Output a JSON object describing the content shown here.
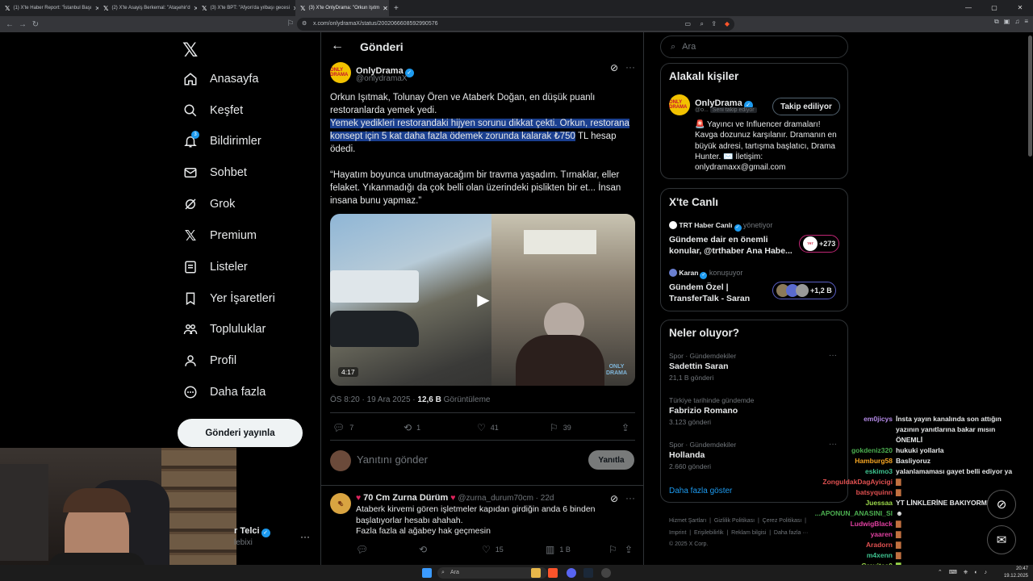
{
  "browser": {
    "tabs": [
      {
        "title": "(1) X'te Haber Report: \"İstanbul Başı"
      },
      {
        "title": "(2) X'te Asayiş Berkemal: \"Ataşehir'd"
      },
      {
        "title": "(3) X'te BPT: \"Afyon'da yılbaşı gecesi"
      },
      {
        "title": "(3) X'te OnlyDrama: \"Orkun Işıtm"
      }
    ],
    "url": "x.com/onlydramaX/status/2002066608592990576"
  },
  "sidebar": {
    "items": [
      {
        "label": "Anasayfa",
        "icon": "home-icon"
      },
      {
        "label": "Keşfet",
        "icon": "search-icon"
      },
      {
        "label": "Bildirimler",
        "icon": "bell-icon",
        "badge": "3"
      },
      {
        "label": "Sohbet",
        "icon": "mail-icon"
      },
      {
        "label": "Grok",
        "icon": "grok-icon"
      },
      {
        "label": "Premium",
        "icon": "x-premium-icon"
      },
      {
        "label": "Listeler",
        "icon": "list-icon"
      },
      {
        "label": "Yer İşaretleri",
        "icon": "bookmark-icon"
      },
      {
        "label": "Topluluklar",
        "icon": "communities-icon"
      },
      {
        "label": "Profil",
        "icon": "profile-icon"
      },
      {
        "label": "Daha fazla",
        "icon": "more-icon"
      }
    ],
    "post_button": "Gönderi yayınla",
    "account_name": "r Telci",
    "account_handle": "lebixi"
  },
  "main": {
    "header_title": "Gönderi",
    "post": {
      "author": "OnlyDrama",
      "handle": "@onlydramaX",
      "avatar_text": "ONLY DRAMA",
      "text_1": "Orkun Işıtmak, Tolunay Ören ve Ataberk Doğan, en düşük puanlı restoranlarda yemek yedi.",
      "text_2_highlight": "Yemek yedikleri restorandaki hijyen sorunu dikkat çekti. Orkun, restorana konsept için 5 kat daha fazla ödemek zorunda kalarak ₺750",
      "text_2_rest": " TL hesap ödedi.",
      "text_3": "“Hayatım boyunca unutmayacağım bir travma yaşadım. Tırnaklar, eller felaket. Yıkanmadığı da çok belli olan üzerindeki pislikten bir et... İnsan insana bunu yapmaz.”",
      "video_duration": "4:17",
      "video_watermark": "ONLY DRAMA",
      "time": "ÖS 8:20 · 19 Ara 2025 · ",
      "views_count": "12,6 B",
      "views_label": " Görüntüleme",
      "replies": "7",
      "reposts": "1",
      "likes": "41",
      "bookmarks": "39"
    },
    "reply_placeholder": "Yanıtını gönder",
    "reply_button": "Yanıtla",
    "comment": {
      "author": "70 Cm Zurna Dürüm",
      "handle": "@zurna_durum70cm · 22d",
      "text": "Ataberk kirvemi gören işletmeler kapıdan girdiğin anda 6 binden başlatıyorlar hesabı ahahah.\nFazla fazla al ağabey hak geçmesin",
      "reposts": "",
      "likes": "15",
      "views": "1 B"
    }
  },
  "right": {
    "search_placeholder": "Ara",
    "related_title": "Alakalı kişiler",
    "related": {
      "name": "OnlyDrama",
      "handle": "@o...",
      "follows_you": "Seni takip ediyor",
      "button": "Takip ediliyor",
      "bio": "🚨 Yayıncı ve Influencer dramaları! Kavga dozunuz karşılanır. Dramanın en büyük adresi, tartışma başlatıcı, Drama Hunter. ✉️ İletişim: onlydramaxx@gmail.com"
    },
    "live_title": "X'te Canlı",
    "live": [
      {
        "host": "TRT Haber Canlı",
        "role": "yönetiyor",
        "title": "Gündeme dair en önemli konular, @trthaber Ana Habe...",
        "count": "+273"
      },
      {
        "host": "Karan",
        "role": "konuşuyor",
        "title": "Gündem Özel | TransferTalk - Saran",
        "count": "+1,2 B"
      }
    ],
    "trends_title": "Neler oluyor?",
    "trends": [
      {
        "context": "Spor · Gündemdekiler",
        "name": "Sadettin Saran",
        "count": "21,1 B gönderi"
      },
      {
        "context": "Türkiye tarihinde gündemde",
        "name": "Fabrizio Romano",
        "count": "3.123 gönderi"
      },
      {
        "context": "Spor · Gündemdekiler",
        "name": "Hollanda",
        "count": "2.660 gönderi"
      }
    ],
    "show_more": "Daha fazla göster",
    "footer_line1": "Hizmet Şartları  |  Gizlilik Politikası  |  Çerez Politikası  |",
    "footer_line2": "Imprint  |  Erişilebilirlik  |  Reklam bilgisi  |  Daha fazla ···",
    "footer_line3": "© 2025 X Corp."
  },
  "chat": [
    {
      "name": "em0jicys",
      "msg": "İnsta yayın kanalında son attığın yazının yanıtlarına bakar mısın ÖNEMLİ",
      "color": "#b58be8"
    },
    {
      "name": "gokdeniz320",
      "msg": "hukuki yollarla",
      "color": "#4caf50"
    },
    {
      "name": "Hamburg58",
      "msg": "Basliyoruz",
      "color": "#f6a623"
    },
    {
      "name": "eskimo3",
      "msg": "yalanlamaması gayet belli ediyor ya",
      "color": "#3ec28f"
    },
    {
      "name": "ZonguldakDagAyicigi",
      "msg": "",
      "color": "#e05050"
    },
    {
      "name": "batsyquinn",
      "msg": "",
      "color": "#e05050"
    },
    {
      "name": "Juessaa",
      "msg": "YT LİNKLERİNE BAKIYORMUSUN",
      "color": "#9bd84a"
    },
    {
      "name": "APONUN_ANASINI_SI...",
      "msg": "",
      "color": "#4caf50"
    },
    {
      "name": "LudwigBlack",
      "msg": "",
      "color": "#e040a0"
    },
    {
      "name": "yaaren",
      "msg": "",
      "color": "#e040a0"
    },
    {
      "name": "Aradorn",
      "msg": "",
      "color": "#e05050"
    },
    {
      "name": "m4xenn",
      "msg": "",
      "color": "#3ec28f"
    },
    {
      "name": "Gravitas0",
      "msg": "",
      "color": "#9bd84a"
    }
  ],
  "taskbar": {
    "search": "Ara",
    "time": "20:47",
    "date": "19.12.2025"
  },
  "colors": {
    "accent": "#1d9bf0",
    "background": "#000000",
    "highlight": "#1a3f8f"
  }
}
